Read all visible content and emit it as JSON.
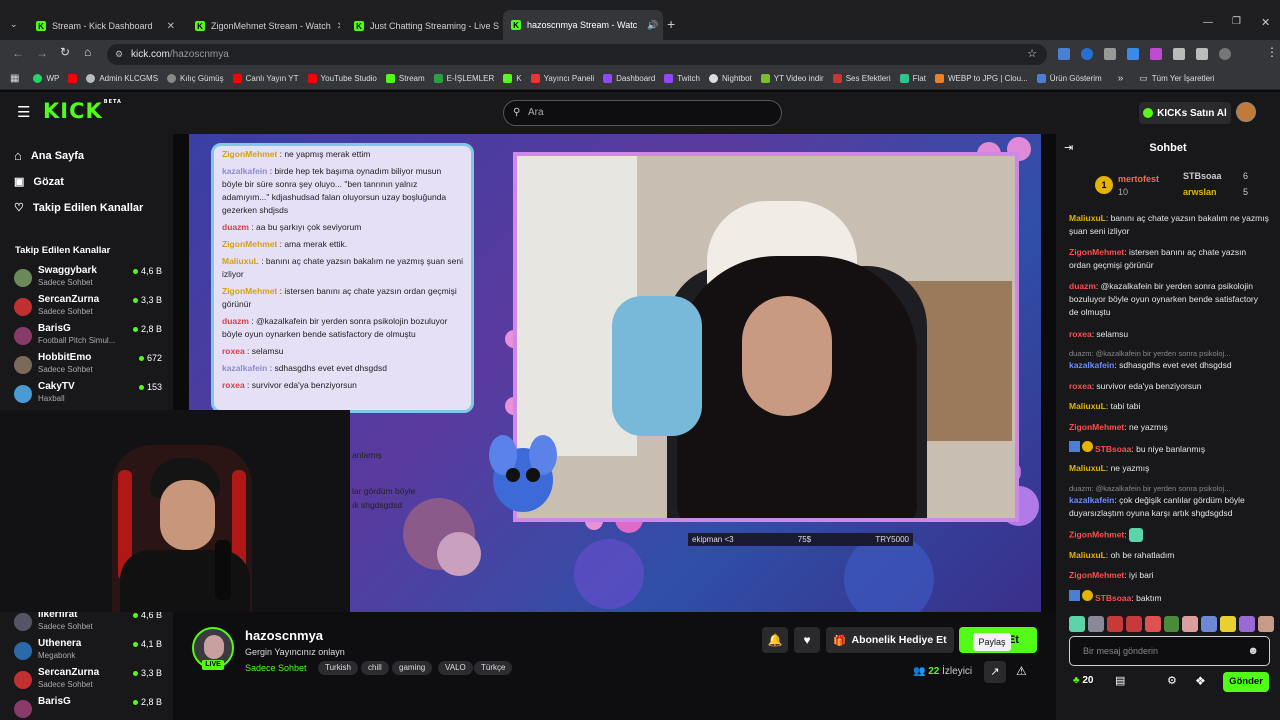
{
  "browser": {
    "tabs": [
      {
        "title": "Stream - Kick Dashboard"
      },
      {
        "title": "ZigonMehmet Stream - Watch"
      },
      {
        "title": "Just Chatting Streaming - Live S"
      },
      {
        "title": "hazoscnmya Stream - Watc"
      }
    ],
    "url_domain": "kick.com",
    "url_path": "/hazoscnmya",
    "bookmarks": [
      "WP",
      "",
      "Admin KLCGMS",
      "Kılıç Gümüş",
      "Canlı Yayın YT",
      "YouTube Studio",
      "Stream",
      "E-İŞLEMLER",
      "K",
      "Yayıncı Paneli",
      "Dashboard",
      "Twitch",
      "Nightbot",
      "YT Video indir",
      "Ses Efektleri",
      "Flat",
      "WEBP to JPG | Clou...",
      "Ürün Gösterim"
    ],
    "bookmarks_more": "»",
    "all_bookmarks": "Tüm Yer İşaretleri"
  },
  "header": {
    "logo": "KICK",
    "logo_sup": "BETA",
    "search_placeholder": "Ara",
    "buy_label": "KICKs Satın Al"
  },
  "sidebar": {
    "nav": [
      {
        "label": "Ana Sayfa",
        "icon": "home-icon"
      },
      {
        "label": "Gözat",
        "icon": "browse-icon"
      },
      {
        "label": "Takip Edilen Kanallar",
        "icon": "heart-icon"
      }
    ],
    "section_title": "Takip Edilen Kanallar",
    "channels": [
      {
        "name": "Swaggybark",
        "sub": "Sadece Sohbet",
        "viewers": "4,6 B"
      },
      {
        "name": "SercanZurna",
        "sub": "Sadece Sohbet",
        "viewers": "3,3 B"
      },
      {
        "name": "BarisG",
        "sub": "Football Pitch Simul...",
        "viewers": "2,8 B"
      },
      {
        "name": "HobbitEmo",
        "sub": "Sadece Sohbet",
        "viewers": "672"
      },
      {
        "name": "CakyTV",
        "sub": "Haxball",
        "viewers": "153"
      }
    ],
    "lower_channels": [
      {
        "name": "ilkerfirat",
        "sub": "Sadece Sohbet",
        "viewers": "4,6 B"
      },
      {
        "name": "Uthenera",
        "sub": "Megabonk",
        "viewers": "4,1 B"
      },
      {
        "name": "SercanZurna",
        "sub": "Sadece Sohbet",
        "viewers": "3,3 B"
      },
      {
        "name": "BarisG",
        "sub": "",
        "viewers": "2,8 B"
      }
    ]
  },
  "overlay_chat": [
    {
      "user": "ZigonMehmet",
      "text": " : ne yapmış merak ettim",
      "color": "#d4a017"
    },
    {
      "user": "kazalkafein",
      "text": " : birde hep tek başıma oynadım biliyor musun böyle bir süre sonra şey oluyo... \"ben tanrının yalnız adamıyım...\" kdjashudsad falan oluyorsun uzay boşluğunda gezerken shdjsds",
      "color": "#8c8cc8"
    },
    {
      "user": "duazm",
      "text": " : aa bu şarkıyı çok seviyorum",
      "color": "#d9404a"
    },
    {
      "user": "ZigonMehmet",
      "text": " : ama merak ettik.",
      "color": "#d4a017"
    },
    {
      "user": "MaliuxuL",
      "text": " : banını aç chate yazsın bakalım ne yazmış şuan seni izliyor",
      "color": "#d4a017"
    },
    {
      "user": "ZigonMehmet",
      "text": " : istersen banını aç chate yazsın ordan geçmişi görünür",
      "color": "#d4a017"
    },
    {
      "user": "duazm",
      "text": " : @kazalkafein bir yerden sonra psikolojin bozuluyor böyle oyun oynarken bende satisfactory de olmuştu",
      "color": "#d9404a"
    },
    {
      "user": "roxea",
      "text": " : selamsu",
      "color": "#d9404a"
    },
    {
      "user": "kazalkafein",
      "text": " : sdhasgdhs evet evet dhsgdsd",
      "color": "#8c8cc8"
    },
    {
      "user": "roxea",
      "text": " : survivor eda'ya benziyorsun",
      "color": "#d9404a"
    }
  ],
  "overlay_partial": [
    "anlamış",
    "lar gördüm böyle",
    "ık shgdsgdsd"
  ],
  "stream_bar": {
    "left": "ekipman <3",
    "mid": "75$",
    "right": "TRY5000"
  },
  "stream": {
    "name": "hazoscnmya",
    "live": "LIVE",
    "title": "Gergin Yayıncınız onlayn",
    "category": "Sadece Sohbet",
    "tags": [
      "Turkish",
      "chill",
      "gaming",
      "VALO",
      "Türkçe"
    ],
    "subgift_label": "Abonelik Hediye Et",
    "follow_label": "Takip Et",
    "tooltip": "Paylaş",
    "viewers": "22",
    "viewers_label": "İzleyici"
  },
  "chat": {
    "title": "Sohbet",
    "leaders": [
      {
        "name": "mertofest",
        "count": "10"
      },
      {
        "name": "STBsoaa",
        "count": "6"
      },
      {
        "name": "arwslan",
        "count": "5"
      }
    ],
    "messages": [
      {
        "user": "MaliuxuL",
        "text": "banını aç chate yazsın bakalım ne yazmış şuan seni izliyor",
        "color": "#e3b300"
      },
      {
        "user": "ZigonMehmet",
        "text": "istersen banını aç chate yazsın ordan geçmişi görünür",
        "color": "#ff4d4d"
      },
      {
        "user": "duazm",
        "text": "@kazalkafein bir yerden sonra psikolojin bozuluyor böyle oyun oynarken bende satisfactory de olmuştu",
        "color": "#ff4d4d"
      },
      {
        "user": "roxea",
        "text": "selamsu",
        "color": "#ff4d4d"
      },
      {
        "user": "kazalkafein",
        "text": "sdhasgdhs evet evet dhsgdsd",
        "color": "#6b8cff",
        "reply": "duazm: @kazalkafein bir yerden sonra psikoloj..."
      },
      {
        "user": "roxea",
        "text": "survivor eda'ya benziyorsun",
        "color": "#ff4d4d"
      },
      {
        "user": "MaliuxuL",
        "text": "tabi tabi",
        "color": "#e3b300"
      },
      {
        "user": "ZigonMehmet",
        "text": "ne yazmış",
        "color": "#ff4d4d"
      },
      {
        "user": "STBsoaa",
        "text": "bu niye banlanmış",
        "color": "#ff4d4d"
      },
      {
        "user": "MaliuxuL",
        "text": "ne yazmış",
        "color": "#e3b300"
      },
      {
        "user": "kazalkafein",
        "text": "çok değişik canlılar gördüm böyle duyarsızlaştım oyuna karşı artık shgdsgdsd",
        "color": "#6b8cff",
        "reply": "duazm: @kazalkafein bir yerden sonra psikoloj..."
      },
      {
        "user": "ZigonMehmet",
        "text": "",
        "color": "#ff4d4d"
      },
      {
        "user": "MaliuxuL",
        "text": "oh be rahatladım",
        "color": "#e3b300"
      },
      {
        "user": "ZigonMehmet",
        "text": "iyi bari",
        "color": "#ff4d4d"
      },
      {
        "user": "STBsoaa",
        "text": "baktım",
        "color": "#ff4d4d"
      }
    ],
    "input_placeholder": "Bir mesaj gönderin",
    "points": "20",
    "send_label": "Gönder"
  }
}
